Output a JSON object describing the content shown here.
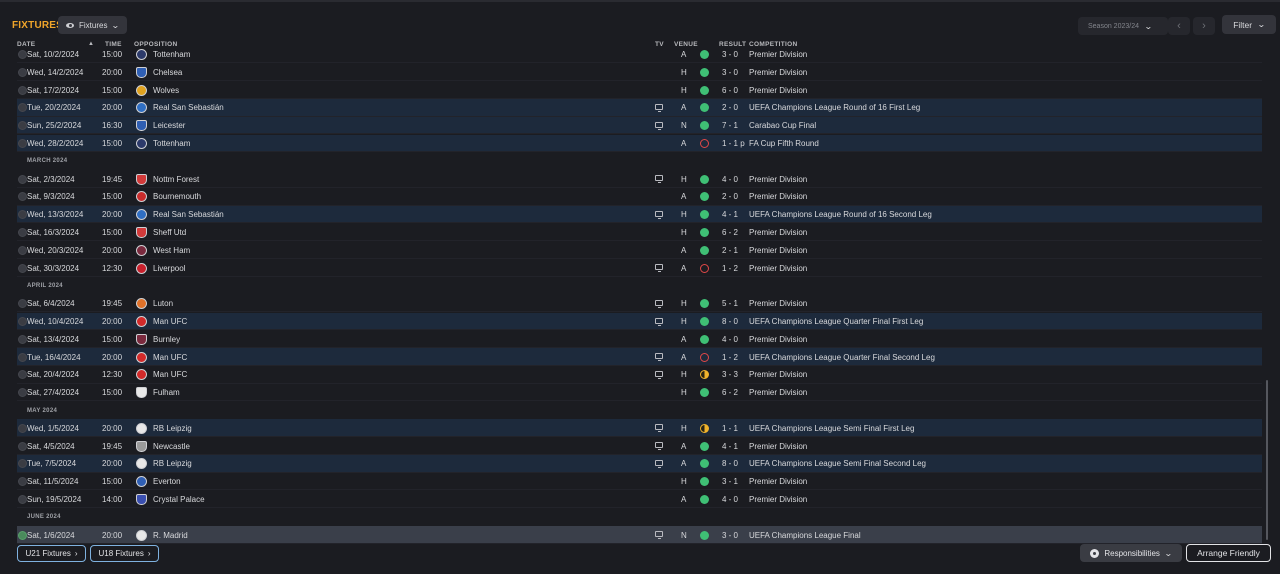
{
  "header": {
    "title": "FIXTURES",
    "view_select": "Fixtures",
    "season": "Season 2023/24",
    "filter": "Filter"
  },
  "columns": {
    "date": "DATE",
    "time": "TIME",
    "opposition": "OPPOSITION",
    "tv": "TV",
    "venue": "VENUE",
    "result": "RESULT",
    "competition": "COMPETITION"
  },
  "rows": [
    {
      "type": "fixture",
      "date": "Sat, 10/2/2024",
      "time": "15:00",
      "opp": "Tottenham",
      "tv": false,
      "venue": "A",
      "res": "W",
      "score": "3 - 0",
      "comp": "Premier Division",
      "hl": false,
      "crest": "#2c3a6a"
    },
    {
      "type": "fixture",
      "date": "Wed, 14/2/2024",
      "time": "20:00",
      "opp": "Chelsea",
      "tv": false,
      "venue": "H",
      "res": "W",
      "score": "3 - 0",
      "comp": "Premier Division",
      "hl": false,
      "crest": "#2f5fb4"
    },
    {
      "type": "fixture",
      "date": "Sat, 17/2/2024",
      "time": "15:00",
      "opp": "Wolves",
      "tv": false,
      "venue": "H",
      "res": "W",
      "score": "6 - 0",
      "comp": "Premier Division",
      "hl": false,
      "crest": "#e0a21f"
    },
    {
      "type": "fixture",
      "date": "Tue, 20/2/2024",
      "time": "20:00",
      "opp": "Real San Sebastián",
      "tv": true,
      "venue": "A",
      "res": "W",
      "score": "2 - 0",
      "comp": "UEFA Champions League Round of 16 First Leg",
      "hl": true,
      "crest": "#2f6fc4"
    },
    {
      "type": "fixture",
      "date": "Sun, 25/2/2024",
      "time": "16:30",
      "opp": "Leicester",
      "tv": true,
      "venue": "N",
      "res": "W",
      "score": "7 - 1",
      "comp": "Carabao Cup Final",
      "hl": true,
      "crest": "#2f5fb4"
    },
    {
      "type": "fixture",
      "date": "Wed, 28/2/2024",
      "time": "15:00",
      "opp": "Tottenham",
      "tv": false,
      "venue": "A",
      "res": "L",
      "score": "1 - 1 p",
      "comp": "FA Cup Fifth Round",
      "hl": true,
      "crest": "#2c3a6a"
    },
    {
      "type": "month",
      "label": "MARCH 2024"
    },
    {
      "type": "fixture",
      "date": "Sat, 2/3/2024",
      "time": "19:45",
      "opp": "Nottm Forest",
      "tv": true,
      "venue": "H",
      "res": "W",
      "score": "4 - 0",
      "comp": "Premier Division",
      "hl": false,
      "crest": "#d23a3a"
    },
    {
      "type": "fixture",
      "date": "Sat, 9/3/2024",
      "time": "15:00",
      "opp": "Bournemouth",
      "tv": false,
      "venue": "A",
      "res": "W",
      "score": "2 - 0",
      "comp": "Premier Division",
      "hl": false,
      "crest": "#c92c2c"
    },
    {
      "type": "fixture",
      "date": "Wed, 13/3/2024",
      "time": "20:00",
      "opp": "Real San Sebastián",
      "tv": true,
      "venue": "H",
      "res": "W",
      "score": "4 - 1",
      "comp": "UEFA Champions League Round of 16 Second Leg",
      "hl": true,
      "crest": "#2f6fc4"
    },
    {
      "type": "fixture",
      "date": "Sat, 16/3/2024",
      "time": "15:00",
      "opp": "Sheff Utd",
      "tv": false,
      "venue": "H",
      "res": "W",
      "score": "6 - 2",
      "comp": "Premier Division",
      "hl": false,
      "crest": "#d23a3a"
    },
    {
      "type": "fixture",
      "date": "Wed, 20/3/2024",
      "time": "20:00",
      "opp": "West Ham",
      "tv": false,
      "venue": "A",
      "res": "W",
      "score": "2 - 1",
      "comp": "Premier Division",
      "hl": false,
      "crest": "#7a2a3e"
    },
    {
      "type": "fixture",
      "date": "Sat, 30/3/2024",
      "time": "12:30",
      "opp": "Liverpool",
      "tv": true,
      "venue": "A",
      "res": "L",
      "score": "1 - 2",
      "comp": "Premier Division",
      "hl": false,
      "crest": "#c8202c"
    },
    {
      "type": "month",
      "label": "APRIL 2024"
    },
    {
      "type": "fixture",
      "date": "Sat, 6/4/2024",
      "time": "19:45",
      "opp": "Luton",
      "tv": true,
      "venue": "H",
      "res": "W",
      "score": "5 - 1",
      "comp": "Premier Division",
      "hl": false,
      "crest": "#e0722a"
    },
    {
      "type": "fixture",
      "date": "Wed, 10/4/2024",
      "time": "20:00",
      "opp": "Man UFC",
      "tv": true,
      "venue": "H",
      "res": "W",
      "score": "8 - 0",
      "comp": "UEFA Champions League Quarter Final First Leg",
      "hl": true,
      "crest": "#d22a2a"
    },
    {
      "type": "fixture",
      "date": "Sat, 13/4/2024",
      "time": "15:00",
      "opp": "Burnley",
      "tv": false,
      "venue": "A",
      "res": "W",
      "score": "4 - 0",
      "comp": "Premier Division",
      "hl": false,
      "crest": "#7a2a3e"
    },
    {
      "type": "fixture",
      "date": "Tue, 16/4/2024",
      "time": "20:00",
      "opp": "Man UFC",
      "tv": true,
      "venue": "A",
      "res": "L",
      "score": "1 - 2",
      "comp": "UEFA Champions League Quarter Final Second Leg",
      "hl": true,
      "crest": "#d22a2a"
    },
    {
      "type": "fixture",
      "date": "Sat, 20/4/2024",
      "time": "12:30",
      "opp": "Man UFC",
      "tv": true,
      "venue": "H",
      "res": "D",
      "score": "3 - 3",
      "comp": "Premier Division",
      "hl": false,
      "crest": "#d22a2a"
    },
    {
      "type": "fixture",
      "date": "Sat, 27/4/2024",
      "time": "15:00",
      "opp": "Fulham",
      "tv": false,
      "venue": "H",
      "res": "W",
      "score": "6 - 2",
      "comp": "Premier Division",
      "hl": false,
      "crest": "#e8e8e8"
    },
    {
      "type": "month",
      "label": "MAY 2024"
    },
    {
      "type": "fixture",
      "date": "Wed, 1/5/2024",
      "time": "20:00",
      "opp": "RB Leipzig",
      "tv": true,
      "venue": "H",
      "res": "D",
      "score": "1 - 1",
      "comp": "UEFA Champions League Semi Final First Leg",
      "hl": true,
      "crest": "#e8e8e8"
    },
    {
      "type": "fixture",
      "date": "Sat, 4/5/2024",
      "time": "19:45",
      "opp": "Newcastle",
      "tv": true,
      "venue": "A",
      "res": "W",
      "score": "4 - 1",
      "comp": "Premier Division",
      "hl": false,
      "crest": "#9a9a9a"
    },
    {
      "type": "fixture",
      "date": "Tue, 7/5/2024",
      "time": "20:00",
      "opp": "RB Leipzig",
      "tv": true,
      "venue": "A",
      "res": "W",
      "score": "8 - 0",
      "comp": "UEFA Champions League Semi Final Second Leg",
      "hl": true,
      "crest": "#e8e8e8"
    },
    {
      "type": "fixture",
      "date": "Sat, 11/5/2024",
      "time": "15:00",
      "opp": "Everton",
      "tv": false,
      "venue": "H",
      "res": "W",
      "score": "3 - 1",
      "comp": "Premier Division",
      "hl": false,
      "crest": "#2f5fb4"
    },
    {
      "type": "fixture",
      "date": "Sun, 19/5/2024",
      "time": "14:00",
      "opp": "Crystal Palace",
      "tv": false,
      "venue": "A",
      "res": "W",
      "score": "4 - 0",
      "comp": "Premier Division",
      "hl": false,
      "crest": "#3a4fb0"
    },
    {
      "type": "month",
      "label": "JUNE 2024"
    },
    {
      "type": "fixture",
      "date": "Sat, 1/6/2024",
      "time": "20:00",
      "opp": "R. Madrid",
      "tv": true,
      "venue": "N",
      "res": "W",
      "score": "3 - 0",
      "comp": "UEFA Champions League Final",
      "hl": true,
      "sel": true,
      "crest": "#e8e8e8"
    }
  ],
  "footer": {
    "u21": "U21 Fixtures",
    "u18": "U18 Fixtures",
    "responsibilities": "Responsibilities",
    "arrange": "Arrange Friendly"
  }
}
